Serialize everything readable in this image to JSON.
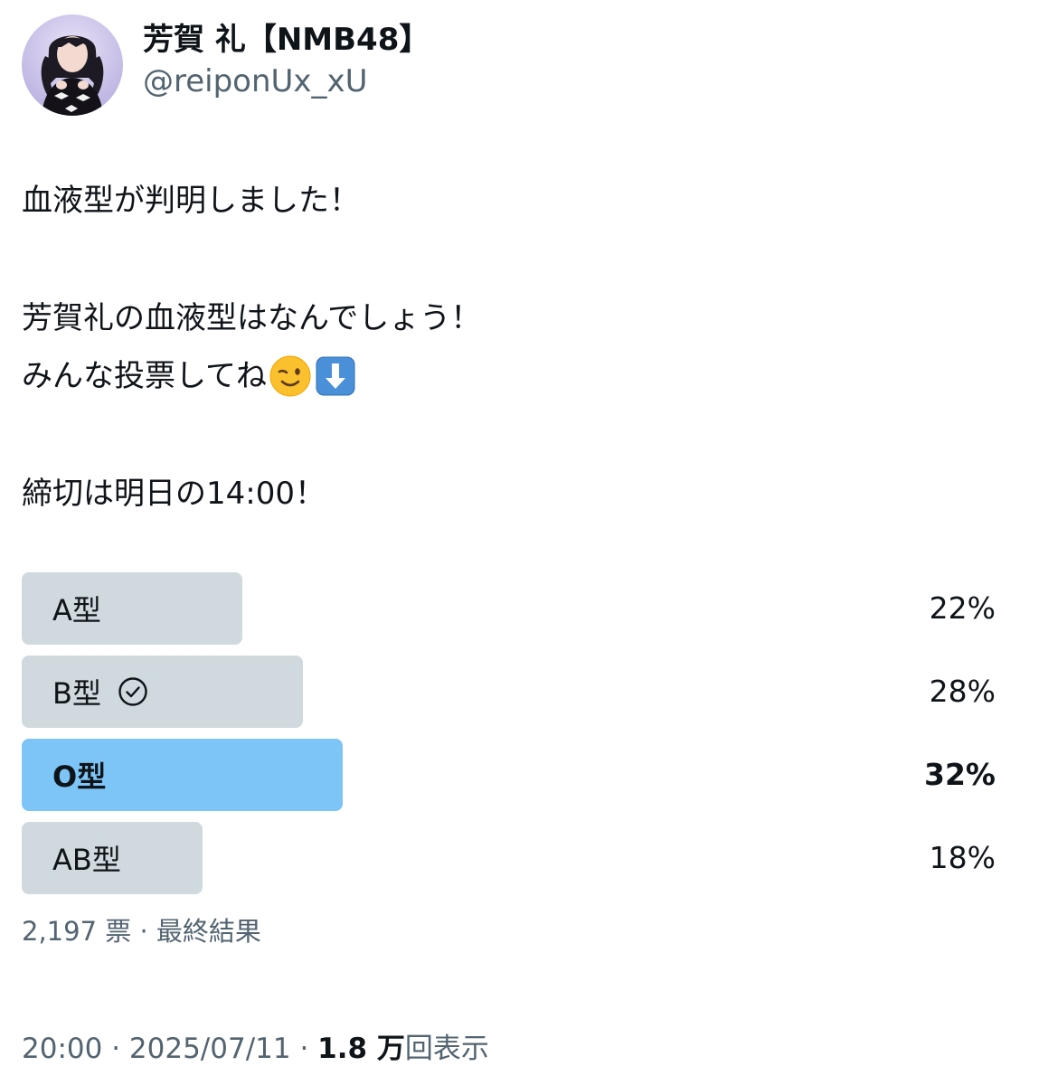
{
  "user": {
    "display_name": "芳賀 礼【NMB48】",
    "handle": "@reiponUx_xU",
    "avatar_icon": "profile-avatar"
  },
  "tweet": {
    "line1": "血液型が判明しました！",
    "line2": "芳賀礼の血液型はなんでしょう！",
    "line3": "みんな投票してね",
    "line3_emojis": [
      "winking-face-emoji",
      "down-arrow-emoji"
    ],
    "line4": "締切は明日の14:00！"
  },
  "poll": {
    "options": [
      {
        "label": "A型",
        "percent_text": "22%",
        "percent": 22,
        "winner": false,
        "user_choice": false
      },
      {
        "label": "B型",
        "percent_text": "28%",
        "percent": 28,
        "winner": false,
        "user_choice": true
      },
      {
        "label": "O型",
        "percent_text": "32%",
        "percent": 32,
        "winner": true,
        "user_choice": false
      },
      {
        "label": "AB型",
        "percent_text": "18%",
        "percent": 18,
        "winner": false,
        "user_choice": false
      }
    ],
    "votes": "2,197 票",
    "separator": " · ",
    "status": "最終結果"
  },
  "meta": {
    "time": "20:00",
    "date": "2025/07/11",
    "views_count": "1.8 万",
    "views_label": "回表示",
    "separator": " · "
  },
  "colors": {
    "bar_default": "#cfd9de",
    "bar_winner": "#7dc4f7",
    "text_primary": "#0f1419",
    "text_secondary": "#536471"
  }
}
